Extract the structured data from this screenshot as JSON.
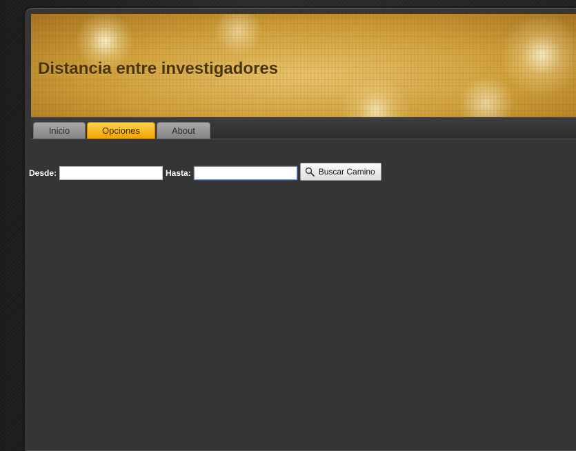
{
  "header": {
    "title": "Distancia entre investigadores"
  },
  "nav": {
    "tabs": [
      {
        "label": "Inicio",
        "active": false
      },
      {
        "label": "Opciones",
        "active": true
      },
      {
        "label": "About",
        "active": false
      }
    ]
  },
  "search": {
    "from_label": "Desde:",
    "from_value": "",
    "to_label": "Hasta:",
    "to_value": "",
    "button_label": "Buscar Camino",
    "button_icon": "magnifier-icon"
  },
  "colors": {
    "accent_tab": "#f5b400",
    "page_background": "#353535",
    "title_color": "#4a3406"
  }
}
